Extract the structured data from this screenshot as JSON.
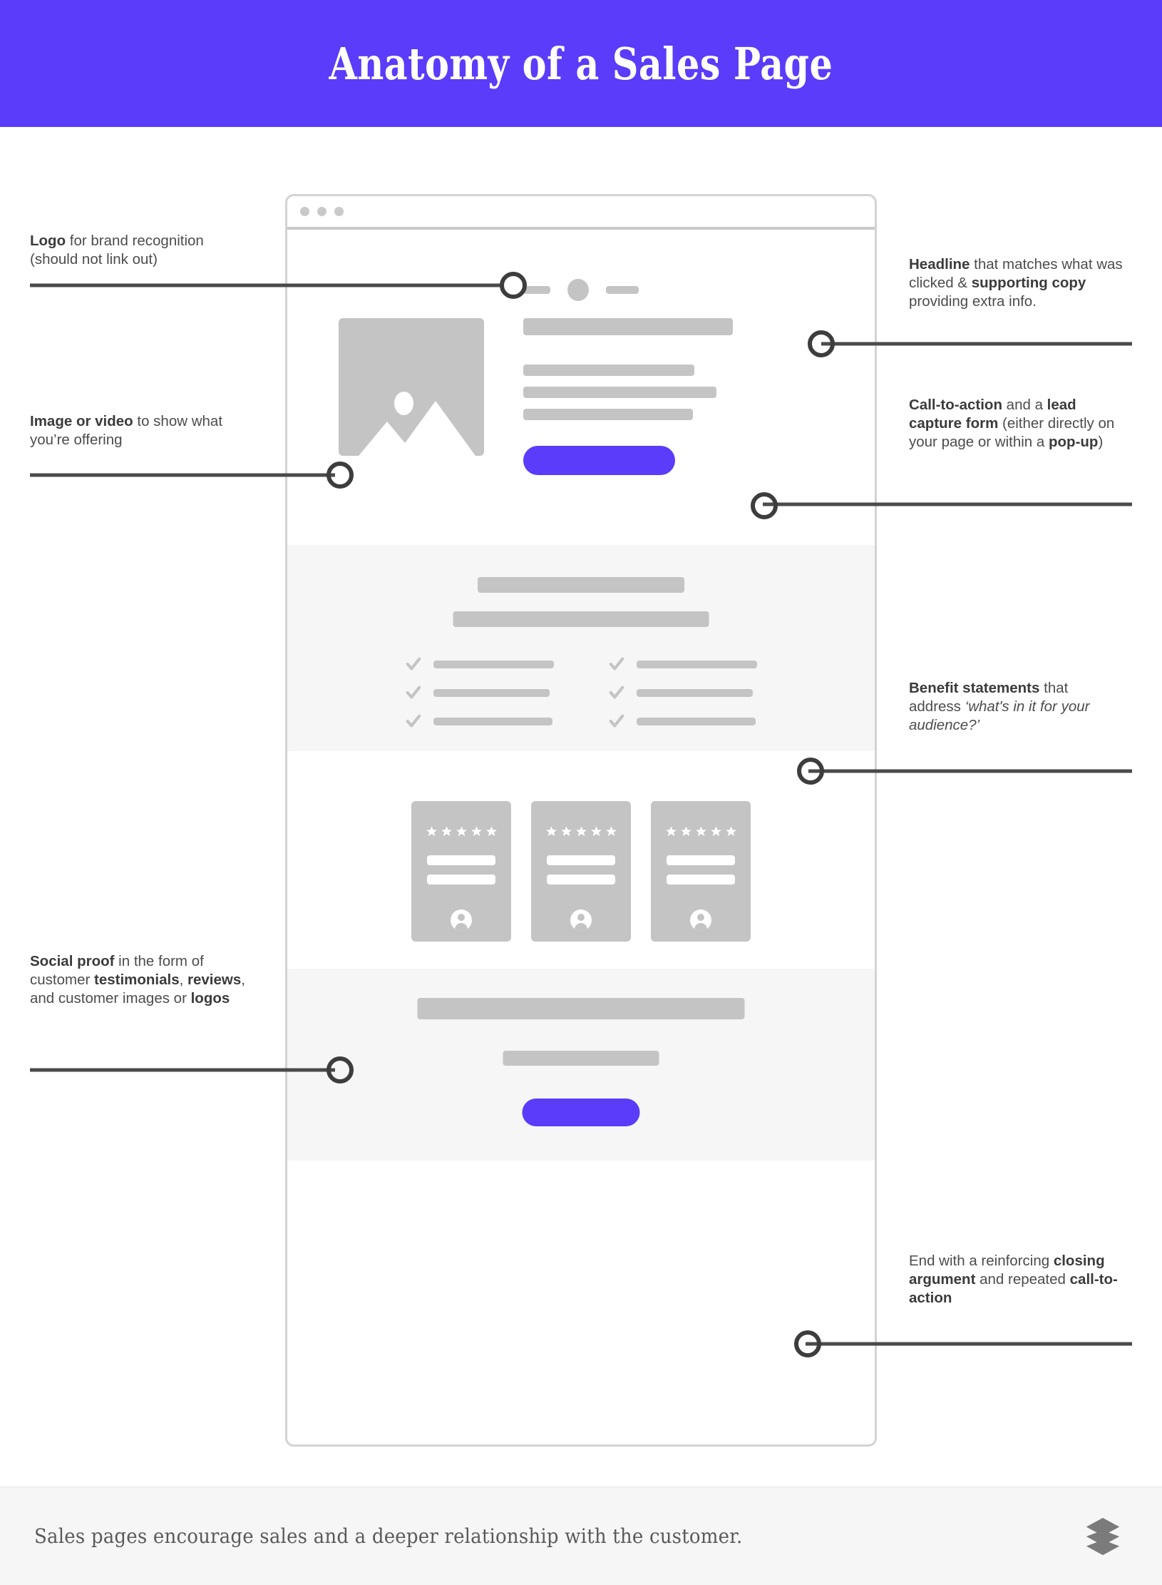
{
  "header": {
    "title": "Anatomy of a Sales Page",
    "background_color": "#5a3cfa",
    "text_color": "#ffffff"
  },
  "theme": {
    "accent": "#5a3cfa",
    "placeholder_gray": "#c4c4c4",
    "section_bg": "#f6f6f6",
    "connector": "#4a4a4a",
    "body_text": "#4c4c4c"
  },
  "mockup": {
    "name": "sales-page-wireframe",
    "chrome_dots": 3,
    "sections": {
      "nav": {
        "logo": "circle-logo-placeholder",
        "nav_items": 2
      },
      "hero": {
        "media": "image-placeholder",
        "headline_bar": "headline-placeholder",
        "copy_lines": 3,
        "cta_label": "cta-button-placeholder"
      },
      "benefits": {
        "title_bars": 2,
        "columns": 2,
        "items_per_column": 3,
        "bullet_icon": "check-icon"
      },
      "social_proof": {
        "cards": 3,
        "stars_per_card": 5,
        "text_bars_per_card": 2,
        "avatar": "person-avatar-icon"
      },
      "closing": {
        "headline_bar": "closing-headline-placeholder",
        "subtext_bar": "closing-subtext-placeholder",
        "cta_label": "closing-cta-button-placeholder"
      }
    }
  },
  "annotations": {
    "logo": {
      "id": "logo",
      "side": "left",
      "segments": [
        {
          "text": "Logo",
          "bold": true
        },
        {
          "text": " for brand recognition (should not link out)",
          "bold": false
        }
      ],
      "plain": "Logo for brand recognition (should not link out)"
    },
    "image": {
      "id": "image-or-video",
      "side": "left",
      "segments": [
        {
          "text": "Image or video",
          "bold": true
        },
        {
          "text": " to show what you’re offering",
          "bold": false
        }
      ],
      "plain": "Image or video to show what you’re offering"
    },
    "social_proof": {
      "id": "social-proof",
      "side": "left",
      "segments": [
        {
          "text": "Social proof",
          "bold": true
        },
        {
          "text": " in the form of customer ",
          "bold": false
        },
        {
          "text": "testimonials",
          "bold": true
        },
        {
          "text": ", ",
          "bold": false
        },
        {
          "text": "reviews",
          "bold": true
        },
        {
          "text": ", and customer images or ",
          "bold": false
        },
        {
          "text": "logos",
          "bold": true
        }
      ],
      "plain": "Social proof in the form of customer testimonials, reviews, and customer images or logos"
    },
    "headline": {
      "id": "headline",
      "side": "right",
      "segments": [
        {
          "text": "Headline",
          "bold": true
        },
        {
          "text": " that matches what was clicked & ",
          "bold": false
        },
        {
          "text": "supporting copy",
          "bold": true
        },
        {
          "text": " providing extra info.",
          "bold": false
        }
      ],
      "plain": "Headline that matches what was clicked & supporting copy providing extra info."
    },
    "cta": {
      "id": "call-to-action",
      "side": "right",
      "segments": [
        {
          "text": "Call-to-action",
          "bold": true
        },
        {
          "text": " and a ",
          "bold": false
        },
        {
          "text": "lead capture form",
          "bold": true
        },
        {
          "text": " (either directly on your page or within a ",
          "bold": false
        },
        {
          "text": "pop-up",
          "bold": true
        },
        {
          "text": ")",
          "bold": false
        }
      ],
      "plain": "Call-to-action and a lead capture form (either directly on your page or within a pop-up)"
    },
    "benefits": {
      "id": "benefit-statements",
      "side": "right",
      "segments": [
        {
          "text": "Benefit statements",
          "bold": true
        },
        {
          "text": " that address ",
          "bold": false
        },
        {
          "text": "‘what's in it for your audience?’",
          "italic": true
        }
      ],
      "plain": "Benefit statements that address ‘what's in it for your audience?’"
    },
    "closing": {
      "id": "closing-argument",
      "side": "right",
      "segments": [
        {
          "text": "End with a reinforcing ",
          "bold": false
        },
        {
          "text": "closing argument",
          "bold": true
        },
        {
          "text": " and repeated ",
          "bold": false
        },
        {
          "text": "call-to-action",
          "bold": true
        }
      ],
      "plain": "End with a reinforcing closing argument and repeated call-to-action"
    }
  },
  "footer": {
    "caption": "Sales pages encourage sales and a deeper relationship with the customer.",
    "logo_icon": "layers-icon"
  }
}
